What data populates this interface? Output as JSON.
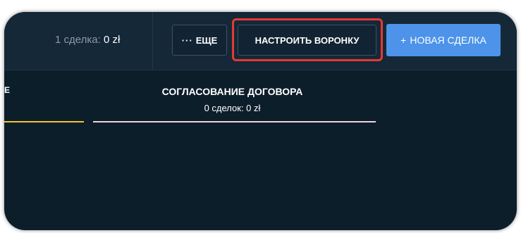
{
  "header": {
    "summary_count": "1 сделка:",
    "summary_value": "0 zł",
    "more_label": "ЕЩЕ",
    "more_icon": "ellipsis-icon",
    "configure_label": "НАСТРОИТЬ ВОРОНКУ",
    "new_deal_plus": "+",
    "new_deal_label": "НОВАЯ СДЕЛКА"
  },
  "pipeline": {
    "prev_stage_fragment": "Е",
    "stage": {
      "title": "СОГЛАСОВАНИЕ ДОГОВОРА",
      "count": "0 сделок: 0 zł"
    }
  },
  "colors": {
    "background": "#0d1e2b",
    "primary_button": "#4c93e9",
    "highlight_box": "#e53935",
    "prev_stage_bar": "#f4c430",
    "stage_bar": "#f3d3de"
  }
}
